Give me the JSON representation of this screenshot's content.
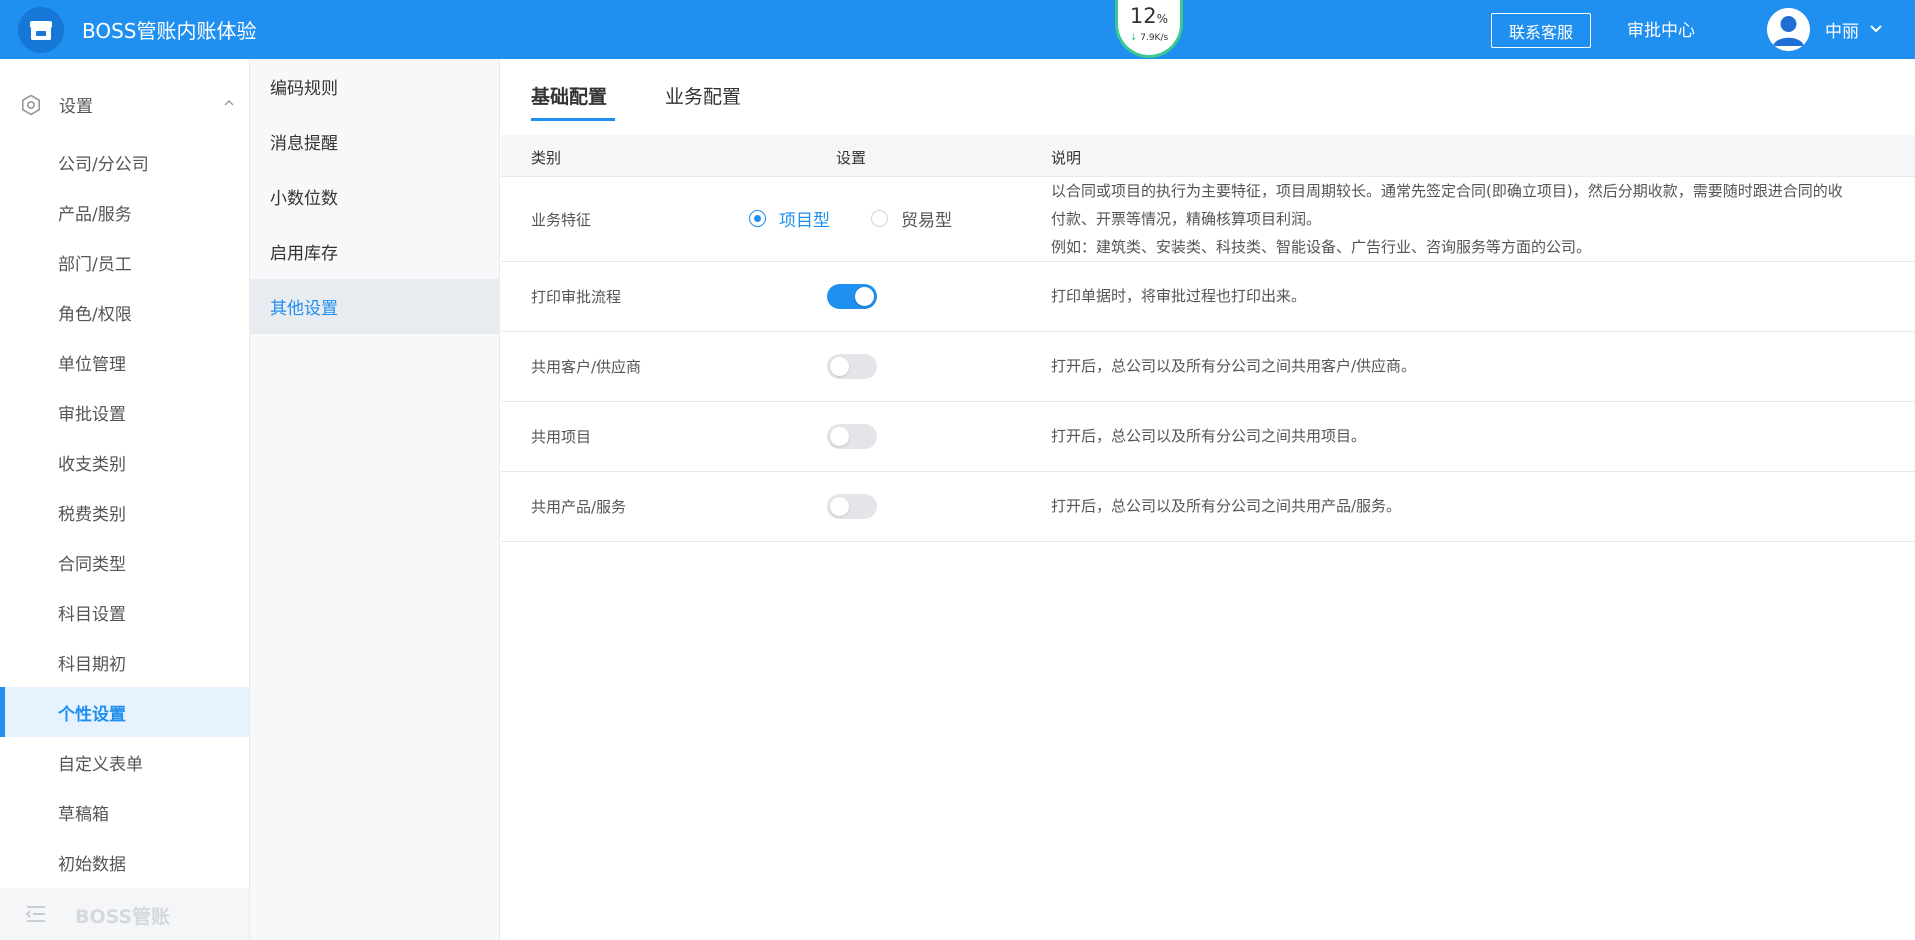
{
  "header": {
    "app_title": "BOSS管账内账体验",
    "speed": {
      "percent": "12",
      "percent_unit": "%",
      "rate": "7.9K/s"
    },
    "contact_label": "联系客服",
    "approval_center_label": "审批中心",
    "user_name": "中丽"
  },
  "sidebar": {
    "group_label": "设置",
    "items": [
      {
        "label": "公司/分公司"
      },
      {
        "label": "产品/服务"
      },
      {
        "label": "部门/员工"
      },
      {
        "label": "角色/权限"
      },
      {
        "label": "单位管理"
      },
      {
        "label": "审批设置"
      },
      {
        "label": "收支类别"
      },
      {
        "label": "税费类别"
      },
      {
        "label": "合同类型"
      },
      {
        "label": "科目设置"
      },
      {
        "label": "科目期初"
      },
      {
        "label": "个性设置"
      },
      {
        "label": "自定义表单"
      },
      {
        "label": "草稿箱"
      },
      {
        "label": "初始数据"
      }
    ],
    "active_item": "个性设置",
    "footer_label": "BOSS管账"
  },
  "subnav": {
    "items": [
      {
        "label": "编码规则"
      },
      {
        "label": "消息提醒"
      },
      {
        "label": "小数位数"
      },
      {
        "label": "启用库存"
      },
      {
        "label": "其他设置"
      }
    ],
    "active_item": "其他设置"
  },
  "main": {
    "tabs": [
      {
        "label": "基础配置"
      },
      {
        "label": "业务配置"
      }
    ],
    "active_tab": "基础配置",
    "table": {
      "headers": {
        "category": "类别",
        "setting": "设置",
        "description": "说明"
      },
      "business_row": {
        "category": "业务特征",
        "options": [
          {
            "label": "项目型",
            "checked": true
          },
          {
            "label": "贸易型",
            "checked": false
          }
        ],
        "description_lines": [
          "以合同或项目的执行为主要特征，项目周期较长。通常先签定合同(即确立项目)，然后分期收款，需要随时跟进合同的收",
          "付款、开票等情况，精确核算项目利润。",
          "例如：建筑类、安装类、科技类、智能设备、广告行业、咨询服务等方面的公司。"
        ]
      },
      "toggle_rows": [
        {
          "category": "打印审批流程",
          "enabled": true,
          "description": "打印单据时，将审批过程也打印出来。"
        },
        {
          "category": "共用客户/供应商",
          "enabled": false,
          "description": "打开后，总公司以及所有分公司之间共用客户/供应商。"
        },
        {
          "category": "共用项目",
          "enabled": false,
          "description": "打开后，总公司以及所有分公司之间共用项目。"
        },
        {
          "category": "共用产品/服务",
          "enabled": false,
          "description": "打开后，总公司以及所有分公司之间共用产品/服务。"
        }
      ]
    }
  },
  "colors": {
    "primary": "#1f8ff0",
    "speed_ring": "#3cc98f",
    "toggle_off": "#e3e5e8"
  }
}
